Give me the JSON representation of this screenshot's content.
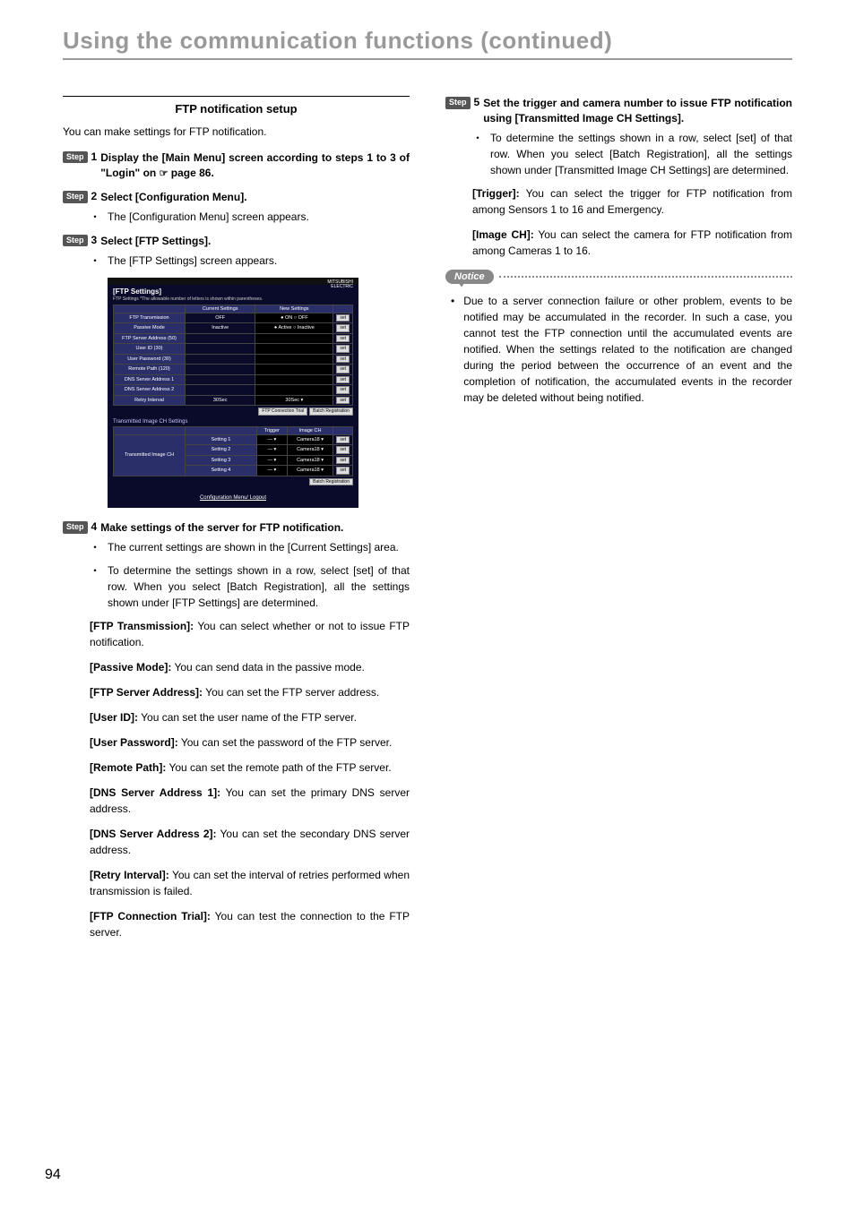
{
  "page": {
    "title": "Using the communication functions (continued)",
    "number": "94"
  },
  "left": {
    "subsection_title": "FTP notification setup",
    "intro": "You can make settings for FTP notification.",
    "step_label": "Step",
    "step1": {
      "num": "1",
      "title_a": "Display the [Main Menu] screen according to steps 1 to 3 of \"Login\" on ",
      "title_b": " page 86."
    },
    "step2": {
      "num": "2",
      "title": "Select [Configuration Menu].",
      "bullet": "The [Configuration Menu] screen appears."
    },
    "step3": {
      "num": "3",
      "title": "Select [FTP Settings].",
      "bullet": "The [FTP Settings] screen appears."
    },
    "step4": {
      "num": "4",
      "title": "Make settings of the server for FTP notification.",
      "bullet1": "The current settings are shown in the [Current Settings] area.",
      "bullet2": "To determine the settings shown in a row, select [set] of that row. When you select [Batch Registration], all the settings shown under [FTP Settings] are determined.",
      "defs": [
        {
          "term": "[FTP Transmission]:",
          "desc": " You can select whether or not to issue FTP notification."
        },
        {
          "term": "[Passive Mode]:",
          "desc": " You can send data in the passive mode."
        },
        {
          "term": "[FTP Server Address]:",
          "desc": " You can set the FTP server address."
        },
        {
          "term": "[User ID]:",
          "desc": " You can set the user name of the FTP server."
        },
        {
          "term": "[User Password]:",
          "desc": " You can set the password of the FTP server."
        },
        {
          "term": "[Remote Path]:",
          "desc": " You can set the remote path of the FTP server."
        },
        {
          "term": "[DNS Server Address 1]:",
          "desc": " You can set the primary DNS server address."
        },
        {
          "term": "[DNS Server Address 2]:",
          "desc": " You can set the secondary DNS server address."
        },
        {
          "term": "[Retry Interval]:",
          "desc": " You can set the interval of retries performed when transmission is failed."
        },
        {
          "term": "[FTP Connection Trial]:",
          "desc": " You can test the connection to the FTP server."
        }
      ]
    },
    "shot": {
      "title": "[FTP Settings]",
      "note": "FTP Settings    *The allowable number of letters is shown within parentheses.",
      "brand1": "MITSUBISHI",
      "brand2": "ELECTRIC",
      "col_current": "Current Settings",
      "col_new": "New Settings",
      "rows": [
        {
          "label": "FTP Transmission",
          "cur": "OFF",
          "new": "● ON  ○ OFF"
        },
        {
          "label": "Passive Mode",
          "cur": "Inactive",
          "new": "● Active  ○ Inactive"
        },
        {
          "label": "FTP Server Address (50)",
          "cur": "",
          "new": ""
        },
        {
          "label": "User ID (30)",
          "cur": "",
          "new": ""
        },
        {
          "label": "User Password (30)",
          "cur": "",
          "new": ""
        },
        {
          "label": "Remote Path (120)",
          "cur": "",
          "new": ""
        },
        {
          "label": "DNS Server Address 1",
          "cur": "",
          "new": ""
        },
        {
          "label": "DNS Server Address 2",
          "cur": "",
          "new": ""
        },
        {
          "label": "Retry Interval",
          "cur": "30Sec",
          "new": "30Sec ▾"
        }
      ],
      "set": "set",
      "conn_trial": "FTP Connection Trial",
      "batch": "Batch Registration",
      "sub_title": "Transmitted Image CH Settings",
      "sub_col_trigger": "Trigger",
      "sub_col_image": "Image CH",
      "sub_left": "Transmitted Image CH",
      "sub_rows": [
        "Setting 1",
        "Setting 2",
        "Setting 3",
        "Setting 4"
      ],
      "dropdown": "— ▾",
      "camera": "Camera18 ▾",
      "logout": "Configuration Menu/ Logout"
    }
  },
  "right": {
    "step5": {
      "num": "5",
      "title": "Set the trigger and camera number to issue FTP notification using [Transmitted Image CH Settings].",
      "bullet": "To determine the settings shown in a row, select [set] of that row. When you select [Batch Registration], all the settings shown under [Transmitted Image CH Settings] are determined.",
      "defs": [
        {
          "term": "[Trigger]:",
          "desc": " You can select the trigger for FTP notification from among Sensors 1 to 16 and Emergency."
        },
        {
          "term": "[Image CH]:",
          "desc": " You can select the camera for FTP notification from among Cameras 1 to 16."
        }
      ]
    },
    "notice": {
      "label": "Notice",
      "text": "Due to a server connection failure or other problem, events to be notified may be accumulated in the recorder. In such a case, you cannot test the FTP connection until the accumulated events are notified. When the settings related to the notification are changed during the period between the occurrence of an event and the completion of notification, the accumulated events in the recorder may be deleted without being notified."
    }
  }
}
